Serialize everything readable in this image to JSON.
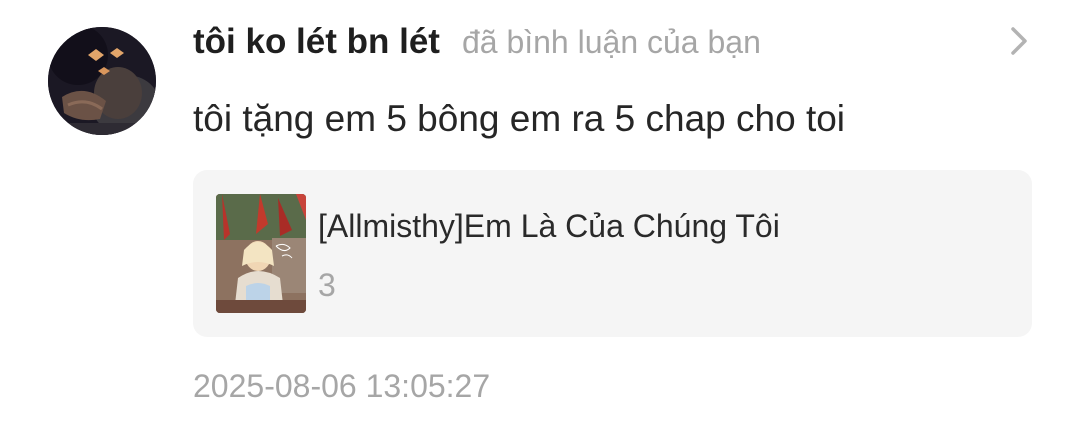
{
  "notification": {
    "username": "tôi ko lét bn lét",
    "action": "đã bình luận của bạn",
    "comment": "tôi tặng em 5 bông em ra 5 chap cho toi",
    "timestamp": "2025-08-06 13:05:27"
  },
  "story": {
    "title": "[Allmisthy]Em Là Của Chúng Tôi",
    "chapter": "3"
  },
  "icons": {
    "open": "chevron-right-icon"
  },
  "colors": {
    "username": "#1f1f1f",
    "secondary_text": "#a6a6a6",
    "card_background": "#f5f5f5"
  }
}
